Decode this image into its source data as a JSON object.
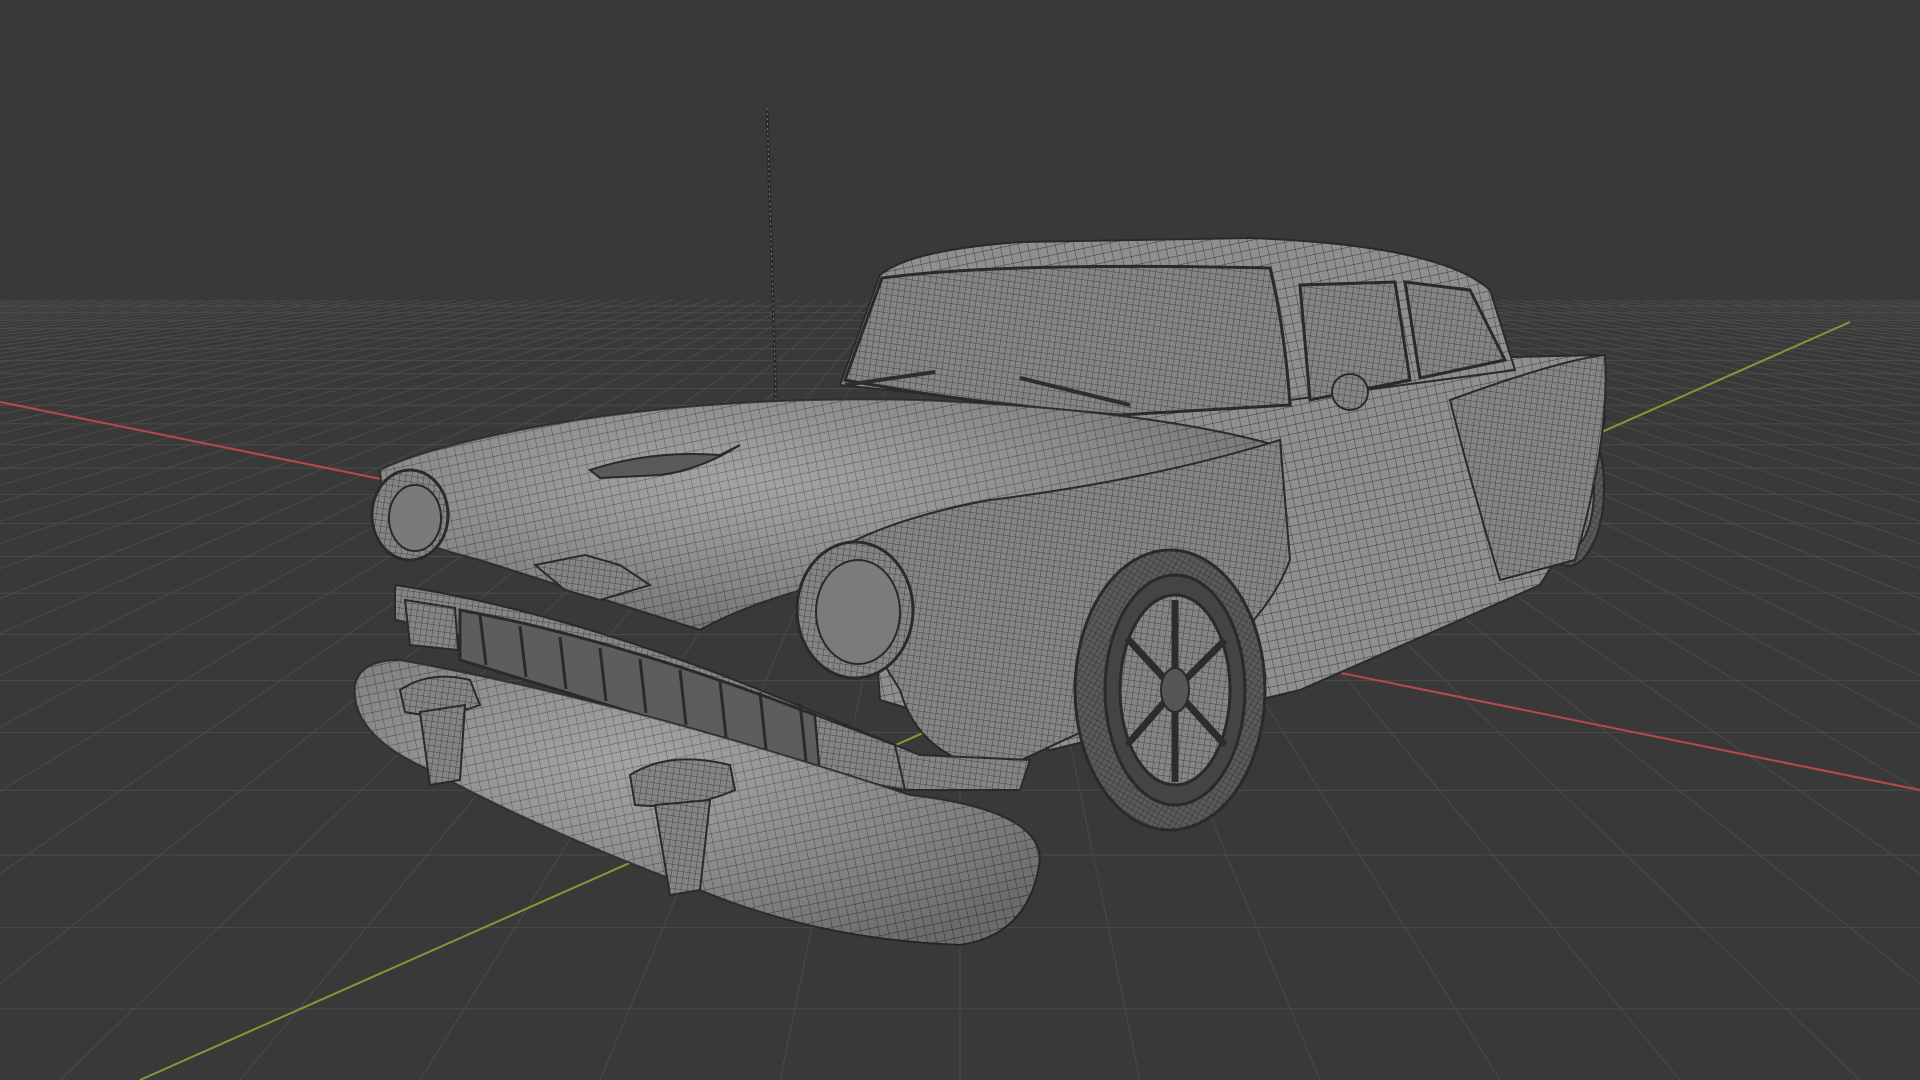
{
  "viewport": {
    "kind": "3d-viewport",
    "shading": "wireframe-overlay-solid",
    "object": "car-model",
    "colors": {
      "background": "#393939",
      "grid_line": "#4a4a4a",
      "x_axis": "#b8494d",
      "y_axis": "#7e9c34",
      "mesh_fill": "#8f8f8f",
      "mesh_dark": "#5f5f5f",
      "mesh_wire": "#2e2e2e",
      "tire": "#3b3b3b"
    }
  }
}
